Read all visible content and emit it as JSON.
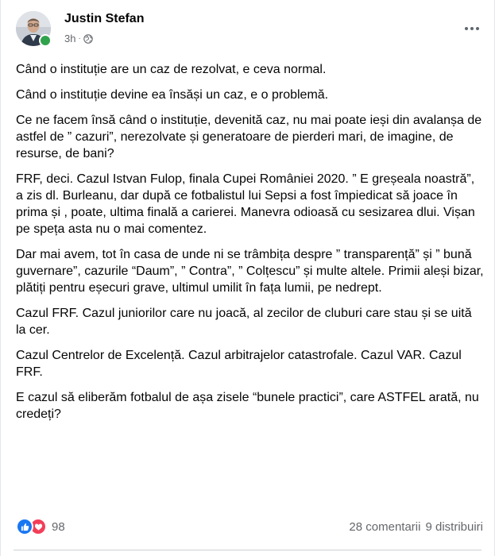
{
  "post": {
    "author": "Justin Stefan",
    "time": "3h",
    "paragraphs": [
      "Când o instituție are un caz de rezolvat, e ceva normal.",
      "Când o instituție devine ea însăși un caz, e o problemă.",
      "Ce ne facem însă când o instituție, devenită caz, nu mai poate ieși din avalanșa de astfel de ” cazuri”, nerezolvate și generatoare de pierderi mari, de imagine, de resurse, de bani?",
      "FRF, deci. Cazul Istvan Fulop, finala Cupei României 2020. ” E greșeala noastră”, a zis dl. Burleanu, dar după ce fotbalistul lui Sepsi a fost împiedicat să joace  în prima și , poate, ultima finală a carierei. Manevra odioasă cu sesizarea dlui. Vișan pe speța asta nu o mai comentez.",
      "Dar mai avem, tot în casa de unde ni se trâmbița despre ” transparență” și ” bună guvernare”, cazurile “Daum”, ” Contra”, ” Colțescu” și multe altele. Primii aleși bizar, plătiți pentru eșecuri grave, ultimul umilit în fața lumii, pe nedrept.",
      "Cazul FRF. Cazul juniorilor care nu joacă, al zecilor de cluburi care stau și se uită la cer.",
      "Cazul Centrelor de Excelență. Cazul arbitrajelor catastrofale. Cazul VAR. Cazul FRF.",
      "E cazul să eliberăm fotbalul de așa zisele “bunele practici”, care ASTFEL arată, nu credeți?"
    ]
  },
  "footer": {
    "reaction_count": "98",
    "comments": "28 comentarii",
    "shares": "9 distribuiri"
  },
  "icons": {
    "audience": "globe-icon",
    "more": "more-options-icon",
    "like": "like-reaction-icon",
    "love": "love-reaction-icon"
  },
  "colors": {
    "like": "#1877f2",
    "love": "#f33e58",
    "online": "#31a24c",
    "secondary_text": "#65676b"
  }
}
